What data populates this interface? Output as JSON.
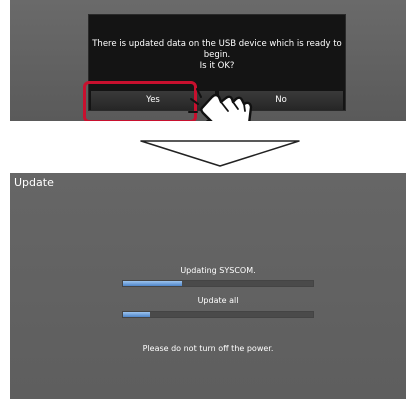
{
  "dialog": {
    "message_lines": [
      "There is updated data on the USB device which is ready to",
      "begin.",
      "Is it OK?"
    ],
    "yes_label": "Yes",
    "no_label": "No",
    "highlight_color": "#c8102e"
  },
  "update_screen": {
    "title": "Update",
    "tasks": [
      {
        "label": "Updating SYSCOM.",
        "progress": 0.31
      },
      {
        "label": "Update all",
        "progress": 0.14
      }
    ],
    "warning": "Please do not turn off the power.",
    "progress_color": "#4f86c9"
  },
  "icons": [
    "hand-pointer-icon",
    "down-arrow-icon"
  ]
}
